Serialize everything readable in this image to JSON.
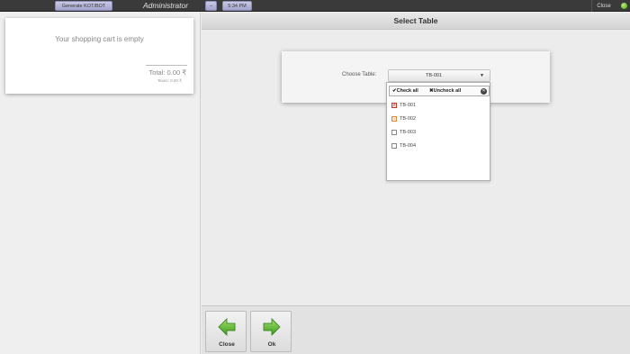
{
  "topbar": {
    "generate_label": "Generate KOT/BOT",
    "title": "Administrator",
    "minus_label": "–",
    "time": "5:34 PM",
    "close_label": "Close",
    "status_color": "#5cb81a"
  },
  "cart": {
    "empty_message": "Your shopping cart is empty",
    "total": "Total: 0.00 ₹",
    "taxes": "Taxes: 0.00 ₹"
  },
  "main": {
    "title": "Select Table",
    "choose_label": "Choose Table:",
    "selected_value": "TB-001"
  },
  "dropdown": {
    "check_all": "✔Check all",
    "uncheck_all": "✖Uncheck all",
    "items": [
      {
        "label": "TB-001",
        "checked": true
      },
      {
        "label": "TB-002",
        "checked": false
      },
      {
        "label": "TB-003",
        "checked": false
      },
      {
        "label": "TB-004",
        "checked": false
      }
    ]
  },
  "toolbar": {
    "close_label": "Close",
    "ok_label": "Ok",
    "close_icon": "arrow-left-icon",
    "ok_icon": "arrow-right-icon",
    "accent": "#4aa32a"
  }
}
